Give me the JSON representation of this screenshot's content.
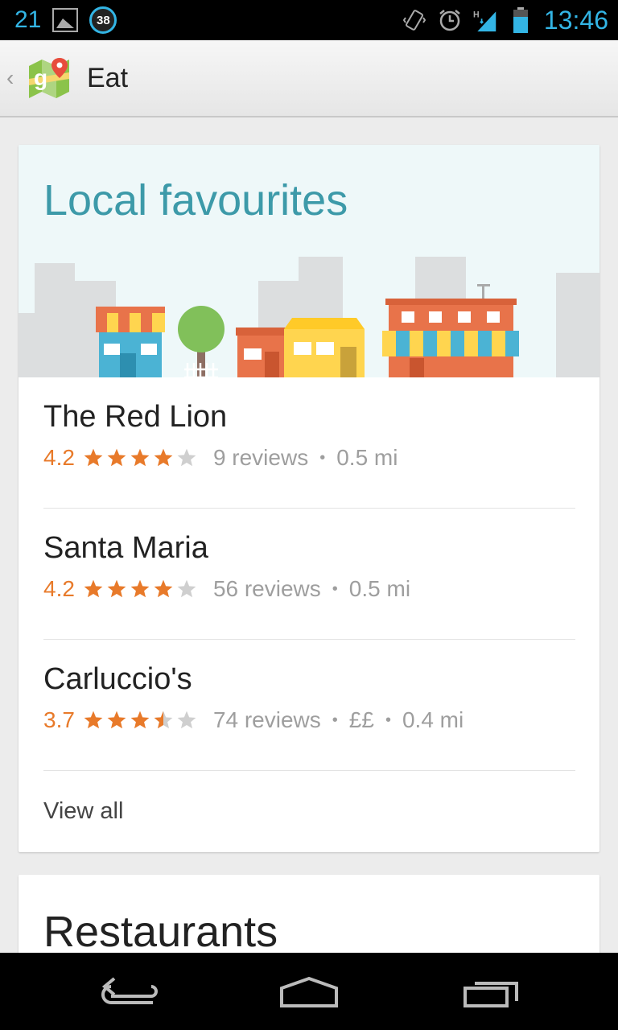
{
  "status_bar": {
    "notification_count": "21",
    "badge_count": "38",
    "time": "13:46",
    "icons": [
      "image-icon",
      "count-badge-icon",
      "vibrate-icon",
      "alarm-icon",
      "signal-icon",
      "battery-icon"
    ]
  },
  "action_bar": {
    "title": "Eat",
    "app_icon": "maps-logo-icon"
  },
  "featured_card": {
    "title": "Local favourites",
    "places": [
      {
        "name": "The Red Lion",
        "rating": "4.2",
        "stars": 4.2,
        "reviews": "9 reviews",
        "price": "",
        "distance": "0.5 mi"
      },
      {
        "name": "Santa Maria",
        "rating": "4.2",
        "stars": 4.2,
        "reviews": "56 reviews",
        "price": "",
        "distance": "0.5 mi"
      },
      {
        "name": "Carluccio's",
        "rating": "3.7",
        "stars": 3.7,
        "reviews": "74 reviews",
        "price": "££",
        "distance": "0.4 mi"
      }
    ],
    "view_all": "View all"
  },
  "second_card": {
    "title": "Restaurants"
  },
  "colors": {
    "accent": "#33b5e5",
    "rating": "#e87a2a",
    "hero_title": "#3d9aa9",
    "hero_bg": "#eef8f9"
  },
  "nav_bar": {
    "icons": [
      "back-icon",
      "home-icon",
      "recent-apps-icon"
    ]
  }
}
